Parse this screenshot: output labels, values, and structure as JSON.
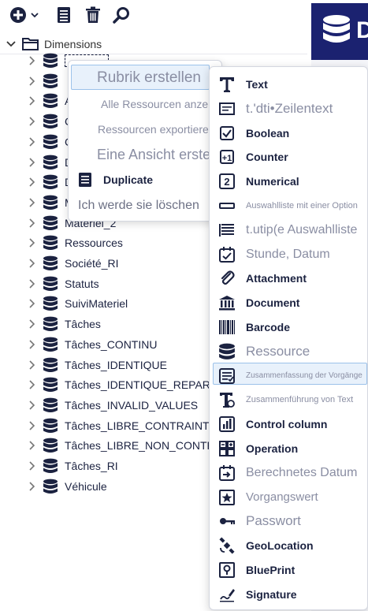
{
  "toolbar": {
    "add_icon": "plus-circle-icon",
    "list_icon": "list-document-icon",
    "trash_icon": "trash-icon",
    "search_icon": "search-icon"
  },
  "colors": {
    "accent": "#1b2270",
    "icon": "#1b2240",
    "highlight": "#e8f1fb",
    "highlight_border": "#9cc2ea"
  },
  "tree": {
    "root_label": "Dimensions",
    "items": [
      {
        "label": "",
        "selected": true
      },
      {
        "label": ""
      },
      {
        "label": "A"
      },
      {
        "label": "C"
      },
      {
        "label": "C"
      },
      {
        "label": "D"
      },
      {
        "label": "D"
      },
      {
        "label": "M"
      },
      {
        "label": "Matériel_2"
      },
      {
        "label": "Ressources"
      },
      {
        "label": "Société_RI"
      },
      {
        "label": "Statuts"
      },
      {
        "label": "SuiviMateriel"
      },
      {
        "label": "Tâches"
      },
      {
        "label": "Tâches_CONTINU"
      },
      {
        "label": "Tâches_IDENTIQUE"
      },
      {
        "label": "Tâches_IDENTIQUE_REPARTIT"
      },
      {
        "label": "Tâches_INVALID_VALUES"
      },
      {
        "label": "Tâches_LIBRE_CONTRAINT"
      },
      {
        "label": "Tâches_LIBRE_NON_CONTRAIN"
      },
      {
        "label": "Tâches_RI"
      },
      {
        "label": "Véhicule"
      }
    ]
  },
  "context_menu": {
    "create_section": "Rubrik erstellen",
    "show_all": "Alle Ressourcen anzeigen",
    "export": "Ressourcen exportieren >",
    "create_view": "Eine Ansicht erstellen",
    "duplicate": "Duplicate",
    "delete": "Ich werde sie löschen"
  },
  "submenu": {
    "items": [
      {
        "label": "Text",
        "icon": "text-T-icon"
      },
      {
        "label": "t.'dti•Zeilentext",
        "icon": "multiline-text-icon"
      },
      {
        "label": "Boolean",
        "icon": "checkbox-icon"
      },
      {
        "label": "Counter",
        "icon": "counter-icon"
      },
      {
        "label": "Numerical",
        "icon": "number-2-icon"
      },
      {
        "label": "Auswahlliste mit einer Option",
        "icon": "single-select-icon"
      },
      {
        "label": "t.utip(e Auswahlliste",
        "icon": "multi-select-icon"
      },
      {
        "label": "Stunde, Datum",
        "icon": "calendar-check-icon"
      },
      {
        "label": "Attachment",
        "icon": "paperclip-icon"
      },
      {
        "label": "Document",
        "icon": "bank-building-icon"
      },
      {
        "label": "Barcode",
        "icon": "barcode-icon"
      },
      {
        "label": "Ressource",
        "icon": "database-icon"
      },
      {
        "label": "Zusammenfassung der Vorgänge",
        "icon": "summary-icon",
        "highlighted": true
      },
      {
        "label": "Zusammenführung von Text",
        "icon": "text-merge-icon"
      },
      {
        "label": "Control column",
        "icon": "bar-chart-icon"
      },
      {
        "label": "Operation",
        "icon": "operation-grid-icon"
      },
      {
        "label": "Berechnetes Datum",
        "icon": "calendar-arrow-icon"
      },
      {
        "label": "Vorgangswert",
        "icon": "star-box-icon"
      },
      {
        "label": "Passwort",
        "icon": "key-icon"
      },
      {
        "label": "GeoLocation",
        "icon": "satellite-icon"
      },
      {
        "label": "BluePrint",
        "icon": "pin-map-icon"
      },
      {
        "label": "Signature",
        "icon": "signature-pen-icon"
      }
    ]
  }
}
